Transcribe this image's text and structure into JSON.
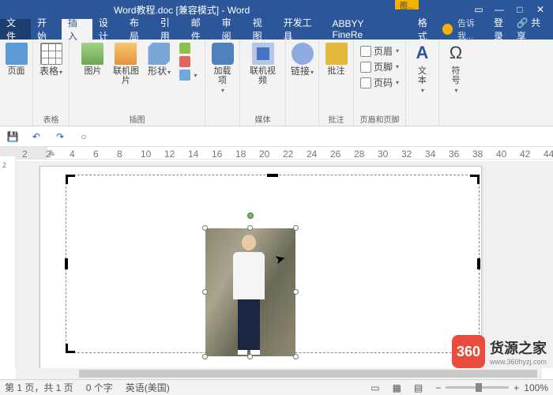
{
  "title": {
    "document": "Word教程.doc [兼容模式] - Word",
    "context_tab": "图..."
  },
  "menu": {
    "file": "文件",
    "home": "开始",
    "insert": "插入",
    "design": "设计",
    "layout": "布局",
    "references": "引用",
    "mailings": "邮件",
    "review": "审阅",
    "view": "视图",
    "devtools": "开发工具",
    "abbyy": "ABBYY FineRe",
    "format": "格式",
    "tellme": "告诉我...",
    "signin": "登录",
    "share": "共享"
  },
  "ribbon": {
    "pages": {
      "cover": "页面",
      "group": "表格"
    },
    "tables": {
      "btn": "表格"
    },
    "illustrations": {
      "pictures": "图片",
      "online": "联机图片",
      "shapes": "形状",
      "group": "插图"
    },
    "addins": {
      "btn": "加载\n项",
      "group": ""
    },
    "media": {
      "btn": "联机视频",
      "group": "媒体"
    },
    "links": {
      "btn": "链接",
      "group": ""
    },
    "comments": {
      "btn": "批注",
      "group": "批注"
    },
    "headerfooter": {
      "header": "页眉",
      "footer": "页脚",
      "pagenum": "页码",
      "group": "页眉和页脚"
    },
    "text": {
      "textbox": "文\n本",
      "symbol": "符\n号"
    }
  },
  "rulerH": {
    "numbers": [
      "2",
      "2",
      "4",
      "6",
      "8",
      "10",
      "12",
      "14",
      "16",
      "18",
      "20",
      "22",
      "24",
      "26",
      "28",
      "30",
      "32",
      "34",
      "36",
      "38",
      "40",
      "42",
      "44"
    ]
  },
  "rulerV": {
    "numbers": [
      "2"
    ]
  },
  "status": {
    "page": "第 1 页，共 1 页",
    "words": "0 个字",
    "lang": "英语(美国)",
    "zoom": "100%"
  },
  "watermark": {
    "badge": "360",
    "title": "货源之家",
    "url": "www.360hyzj.com"
  }
}
